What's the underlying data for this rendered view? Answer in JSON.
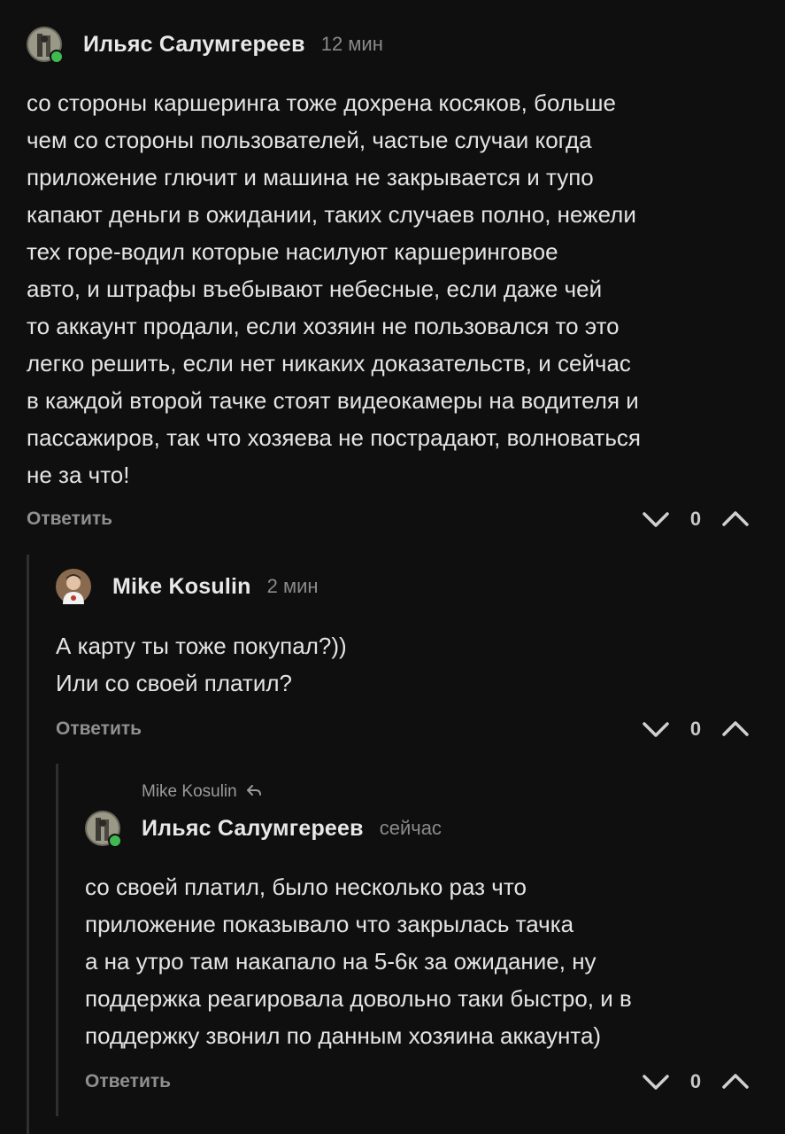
{
  "comments": [
    {
      "author": "Ильяс Салумгереев",
      "time": "12 мин",
      "online": true,
      "text": "со стороны каршеринга тоже дохрена косяков, больше\nчем со стороны пользователей, частые случаи когда\nприложение глючит и машина не закрывается и тупо\nкапают деньги в ожидании, таких случаев полно, нежели\nтех горе-водил которые насилуют каршеринговое\nавто, и штрафы въебывают небесные, если даже чей\nто аккаунт продали, если хозяин не пользовался то это\nлегко решить, если нет никаких доказательств, и сейчас\nв каждой второй тачке стоят видеокамеры на водителя и\nпассажиров, так что хозяева не пострадают, волноваться\nне за что!",
      "reply_label": "Ответить",
      "votes": "0"
    },
    {
      "author": "Mike Kosulin",
      "time": "2 мин",
      "online": false,
      "text": "А карту ты тоже покупал?))\nИли со своей платил?",
      "reply_label": "Ответить",
      "votes": "0"
    },
    {
      "reply_to": "Mike Kosulin",
      "author": "Ильяс Салумгереев",
      "time": "сейчас",
      "online": true,
      "text": "со своей платил, было несколько раз что\nприложение показывало что закрылась тачка\nа на утро там накапало на 5-6к за ожидание, ну\nподдержка реагировала довольно таки быстро, и в\nподдержку звонил по данным хозяина аккаунта)",
      "reply_label": "Ответить",
      "votes": "0"
    }
  ],
  "icons": {
    "downvote": "chevron-down-icon",
    "upvote": "chevron-up-icon",
    "reply_to": "reply-arrow-icon",
    "online": "online-indicator"
  },
  "colors": {
    "background": "#0f0f10",
    "text": "#e4e4e4",
    "muted": "#8a8a8a",
    "online": "#3fb950",
    "thread_line": "#2f2f31"
  }
}
